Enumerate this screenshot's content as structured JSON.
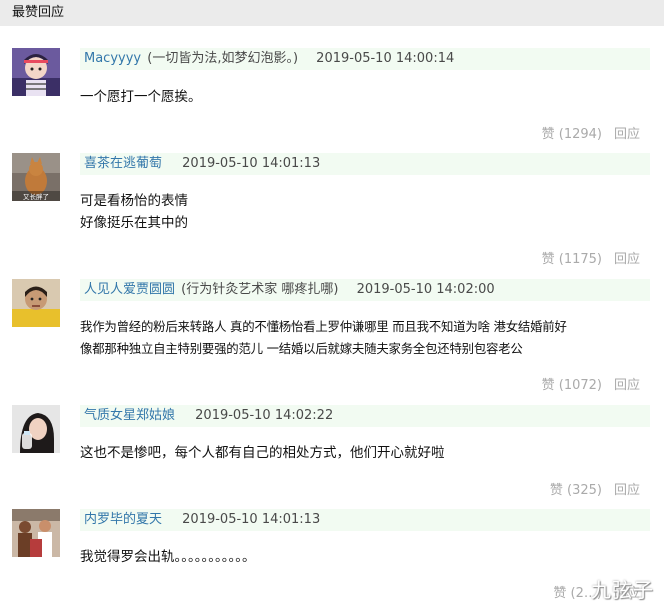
{
  "section_title": "最赞回应",
  "comments": [
    {
      "author": "Macyyyy",
      "signature": "(一切皆为法,如梦幻泡影。)",
      "timestamp": "2019-05-10 14:00:14",
      "lines": [
        "一个愿打一个愿挨。"
      ],
      "likes": "赞 (1294)",
      "reply": "回应"
    },
    {
      "author": "喜茶在逃葡萄",
      "signature": "",
      "timestamp": "2019-05-10 14:01:13",
      "lines": [
        "可是看杨怡的表情",
        "好像挺乐在其中的"
      ],
      "likes": "赞 (1175)",
      "reply": "回应",
      "avatar_caption": "又长胖了"
    },
    {
      "author": "人见人爱贾圆圆",
      "signature": "(行为针灸艺术家 哪疼扎哪)",
      "timestamp": "2019-05-10 14:02:00",
      "lines": [
        "我作为曾经的粉后来转路人 真的不懂杨怡看上罗仲谦哪里 而且我不知道为啥 港女结婚前好",
        "像都那种独立自主特别要强的范儿 一结婚以后就嫁夫随夫家务全包还特别包容老公"
      ],
      "likes": "赞 (1072)",
      "reply": "回应"
    },
    {
      "author": "气质女星郑姑娘",
      "signature": "",
      "timestamp": "2019-05-10 14:02:22",
      "lines": [
        "这也不是惨吧，每个人都有自己的相处方式，他们开心就好啦"
      ],
      "likes": "赞 (325)",
      "reply": "回应"
    },
    {
      "author": "内罗毕的夏天",
      "signature": "",
      "timestamp": "2019-05-10 14:01:13",
      "lines": [
        "我觉得罗会出轨。。。。。。。。。。。"
      ],
      "likes": "赞 (2…)",
      "reply": "回应"
    }
  ],
  "watermark": "九弦子"
}
